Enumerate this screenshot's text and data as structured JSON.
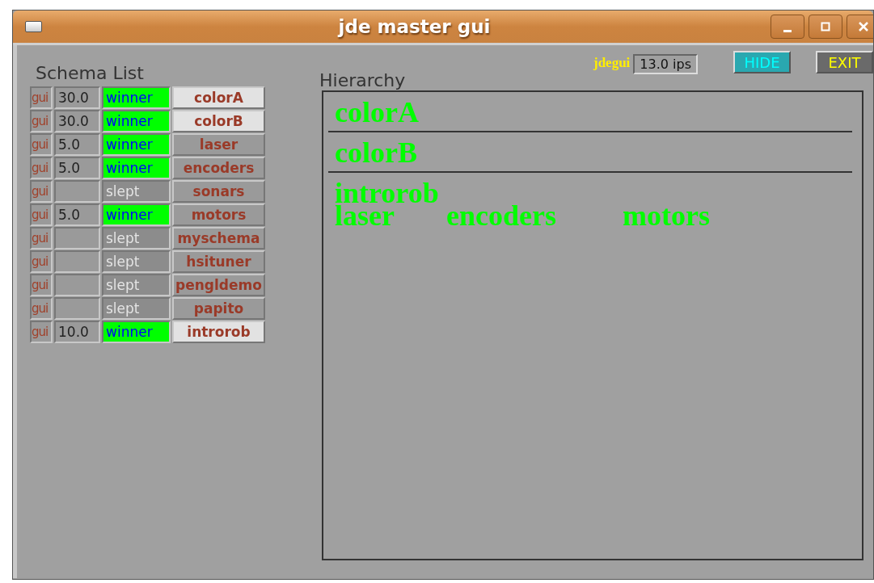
{
  "window": {
    "title": "jde master gui"
  },
  "schema_list": {
    "title": "Schema List",
    "rows": [
      {
        "gui": "gui",
        "frequency": "30.0",
        "state": "winner",
        "name": "colorA",
        "highlighted": true
      },
      {
        "gui": "gui",
        "frequency": "30.0",
        "state": "winner",
        "name": "colorB",
        "highlighted": true
      },
      {
        "gui": "gui",
        "frequency": "5.0",
        "state": "winner",
        "name": "laser",
        "highlighted": false
      },
      {
        "gui": "gui",
        "frequency": "5.0",
        "state": "winner",
        "name": "encoders",
        "highlighted": false
      },
      {
        "gui": "gui",
        "frequency": "",
        "state": "slept",
        "name": "sonars",
        "highlighted": false
      },
      {
        "gui": "gui",
        "frequency": "5.0",
        "state": "winner",
        "name": "motors",
        "highlighted": false
      },
      {
        "gui": "gui",
        "frequency": "",
        "state": "slept",
        "name": "myschema",
        "highlighted": false
      },
      {
        "gui": "gui",
        "frequency": "",
        "state": "slept",
        "name": "hsituner",
        "highlighted": false
      },
      {
        "gui": "gui",
        "frequency": "",
        "state": "slept",
        "name": "pengldemo",
        "highlighted": false
      },
      {
        "gui": "gui",
        "frequency": "",
        "state": "slept",
        "name": "papito",
        "highlighted": false
      },
      {
        "gui": "gui",
        "frequency": "10.0",
        "state": "winner",
        "name": "introrob",
        "highlighted": true
      }
    ]
  },
  "hierarchy": {
    "title": "Hierarchy",
    "app_label": "jdegui",
    "rate": "13.0 ips",
    "buttons": [
      {
        "label": "HIDE",
        "kind": "hide"
      },
      {
        "label": "EXIT",
        "kind": "exit"
      }
    ],
    "items": [
      {
        "name": "colorA"
      },
      {
        "name": "colorB"
      },
      {
        "name": "introrob",
        "children": [
          {
            "name": "laser"
          },
          {
            "name": "encoders"
          },
          {
            "name": "motors"
          }
        ]
      }
    ]
  }
}
